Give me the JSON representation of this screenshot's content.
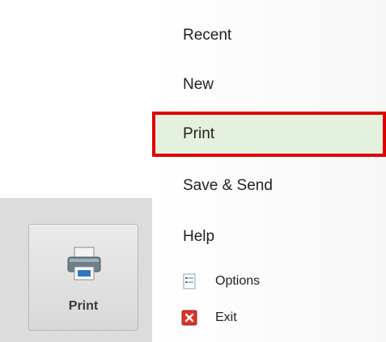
{
  "menu": {
    "recent": "Recent",
    "new": "New",
    "print": "Print",
    "save_send": "Save & Send",
    "help": "Help",
    "options": "Options",
    "exit": "Exit"
  },
  "tile": {
    "label": "Print",
    "icon": "printer-icon"
  },
  "colors": {
    "highlight_border": "#e00000",
    "highlight_fill": "#e5f1df",
    "panel": "#dcdcdc"
  }
}
